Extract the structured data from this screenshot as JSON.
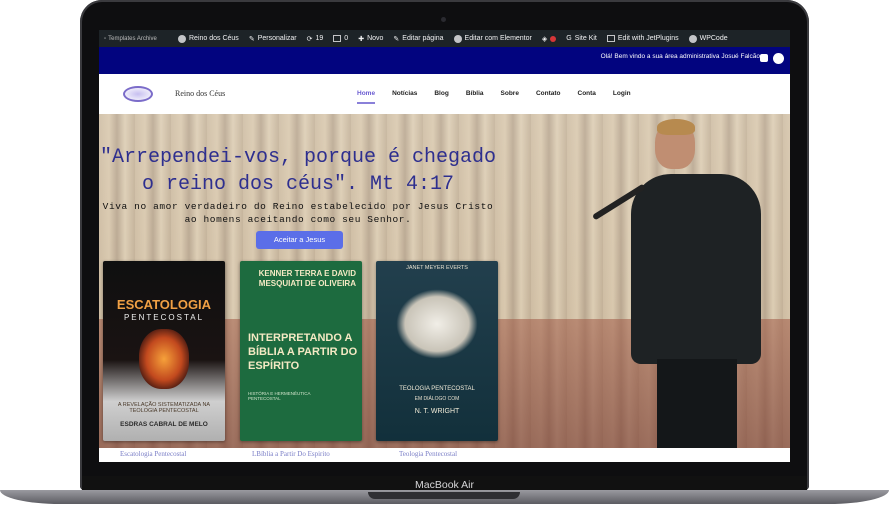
{
  "device": {
    "model": "MacBook Air"
  },
  "adminbar": {
    "logo_alt": "Templates Archive",
    "items": [
      {
        "label": "Reino dos Céus",
        "icon": "home-icon"
      },
      {
        "label": "Personalizar",
        "icon": "brush-icon"
      },
      {
        "label": "19",
        "icon": "updates-icon"
      },
      {
        "label": "0",
        "icon": "comment-icon"
      },
      {
        "label": "Novo",
        "icon": "plus-icon"
      },
      {
        "label": "Editar página",
        "icon": "pencil-icon"
      },
      {
        "label": "Editar com Elementor",
        "icon": "elementor-icon"
      },
      {
        "label": "Site Kit",
        "icon": "google-icon"
      },
      {
        "label": "Edit with JetPlugins",
        "icon": "jet-icon"
      },
      {
        "label": "WPCode",
        "icon": "wpcode-icon"
      }
    ]
  },
  "welcome": {
    "text": "Olá! Bem vindo a sua área administrativa Josué Falcão"
  },
  "header": {
    "site_title": "Reino dos Céus",
    "nav": [
      "Home",
      "Notícias",
      "Blog",
      "Bíblia",
      "Sobre",
      "Contato",
      "Conta",
      "Login"
    ],
    "active": "Home"
  },
  "hero": {
    "quote": "\"Arrependei-vos, porque é chegado o reino dos céus\". Mt 4:17",
    "subtitle": "Viva no amor verdadeiro do Reino estabelecido por Jesus Cristo ao homens aceitando como seu Senhor.",
    "cta": "Aceitar a Jesus"
  },
  "books": [
    {
      "title": "ESCATOLOGIA",
      "subtitle": "PENTECOSTAL",
      "tagline": "A REVELAÇÃO SISTEMATIZADA NA TEOLOGIA PENTECOSTAL",
      "author": "ESDRAS CABRAL DE MELO",
      "caption": "Escatologia Pentecostal"
    },
    {
      "author": "KENNER TERRA E DAVID MESQUIATI DE OLIVEIRA",
      "title": "INTERPRETANDO A BÍBLIA A PARTIR DO ESPÍRITO",
      "subtitle": "HISTÓRIA E HERMENÊUTICA PENTECOSTAL",
      "caption": "LBíblia a Partir Do Espirito"
    },
    {
      "author": "JANET MEYER EVERTS",
      "title": "TEOLOGIA PENTECOSTAL",
      "subtitle": "EM DIÁLOGO COM",
      "name": "N. T. WRIGHT",
      "caption": "Teologia Pentecostal"
    }
  ],
  "colors": {
    "admin_bar": "#1d2327",
    "welcome_bar": "#02047f",
    "accent": "#5b6ee8",
    "quote": "#2e2f8f"
  }
}
